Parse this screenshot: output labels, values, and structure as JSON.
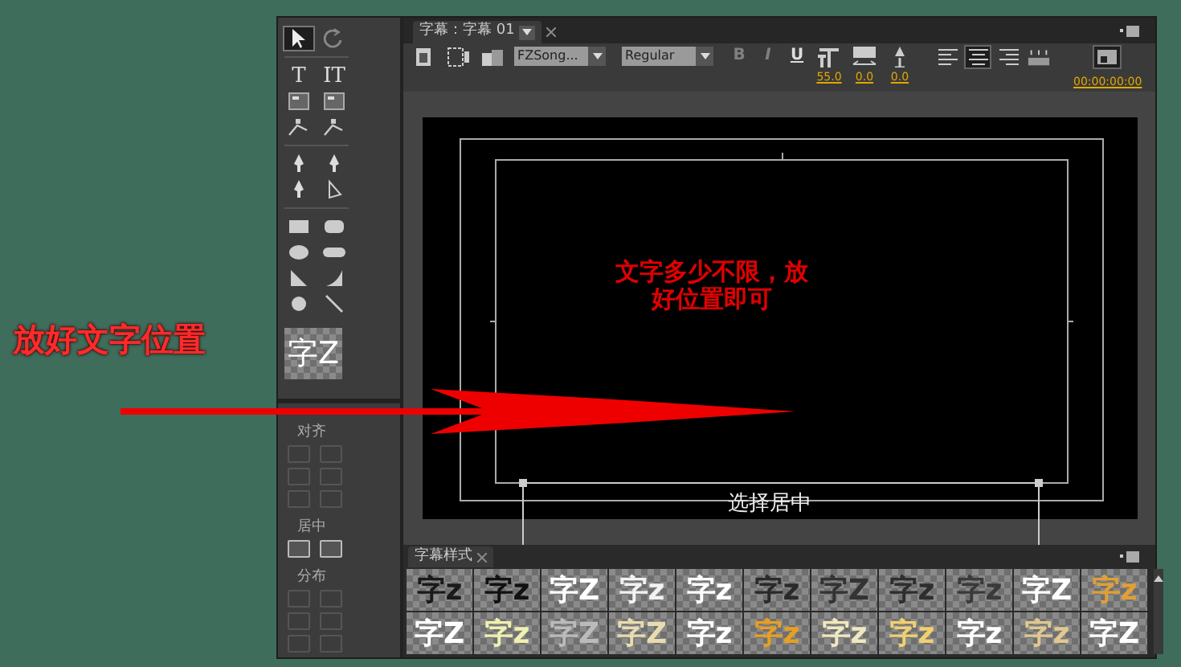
{
  "annotation": {
    "label": "放好文字位置"
  },
  "tools": [
    {
      "kind": "select",
      "selected": true
    },
    {
      "kind": "rotate",
      "selected": false
    },
    {
      "kind": "glyph",
      "label": "T",
      "selected": false
    },
    {
      "kind": "glyph",
      "label": "IT",
      "selected": false
    },
    {
      "kind": "area",
      "selected": false
    },
    {
      "kind": "area",
      "selected": false
    },
    {
      "kind": "path",
      "selected": false
    },
    {
      "kind": "path",
      "selected": false
    },
    {
      "kind": "pen",
      "selected": false
    },
    {
      "kind": "pen",
      "selected": false
    },
    {
      "kind": "pen",
      "selected": false
    },
    {
      "kind": "anchor",
      "selected": false
    },
    {
      "kind": "rect",
      "selected": false
    },
    {
      "kind": "roundrect",
      "selected": false
    },
    {
      "kind": "ellipse",
      "selected": false
    },
    {
      "kind": "pill",
      "selected": false
    },
    {
      "kind": "wedge",
      "selected": false
    },
    {
      "kind": "arc",
      "selected": false
    },
    {
      "kind": "circle",
      "selected": false
    },
    {
      "kind": "line",
      "selected": false
    }
  ],
  "tool_preview": {
    "label": "字Z"
  },
  "side_sections": [
    {
      "label": "对齐",
      "buttons": [
        {
          "disabled": true
        },
        {
          "disabled": true
        },
        {
          "disabled": true
        },
        {
          "disabled": true
        },
        {
          "disabled": true
        },
        {
          "disabled": true
        }
      ]
    },
    {
      "label": "居中",
      "buttons": [
        {
          "disabled": false
        },
        {
          "disabled": false
        }
      ]
    },
    {
      "label": "分布",
      "buttons": [
        {
          "disabled": true
        },
        {
          "disabled": true
        },
        {
          "disabled": true
        },
        {
          "disabled": true
        },
        {
          "disabled": true
        },
        {
          "disabled": true
        }
      ]
    }
  ],
  "panel_tab": {
    "label": "字幕：字幕 01"
  },
  "toolbar": {
    "font_family": "FZSong...",
    "font_style": "Regular",
    "format_buttons": [
      {
        "label": "B",
        "disabled": true
      },
      {
        "label": "I",
        "disabled": true
      },
      {
        "label": "U",
        "disabled": false
      }
    ],
    "font_size": "55.0",
    "kerning": "0.0",
    "leading": "0.0",
    "align_buttons": [
      {
        "selected": false
      },
      {
        "selected": true
      },
      {
        "selected": false
      }
    ],
    "timecode": "00:00:00:00"
  },
  "canvas": {
    "note_lines": [
      "文字多少不限，放",
      "好位置即可"
    ],
    "caption": "选择居中"
  },
  "styles_panel": {
    "title": "字幕样式",
    "swatches": [
      {
        "label": "字z",
        "color": "#1a1a1a"
      },
      {
        "label": "字z",
        "color": "#111111"
      },
      {
        "label": "字Z",
        "color": "#ffffff"
      },
      {
        "label": "字z",
        "color": "#f2f2f2"
      },
      {
        "label": "字z",
        "color": "#ffffff"
      },
      {
        "label": "字z",
        "color": "#2a2a2a"
      },
      {
        "label": "字Z",
        "color": "#333333"
      },
      {
        "label": "字z",
        "color": "#2e2e2e"
      },
      {
        "label": "字z",
        "color": "#3a3a3a"
      },
      {
        "label": "字Z",
        "color": "#ffffff"
      },
      {
        "label": "字z",
        "color": "#e0a035"
      },
      {
        "label": "字Z",
        "color": "#ffffff"
      },
      {
        "label": "字z",
        "color": "#f0f0b0"
      },
      {
        "label": "字Z",
        "color": "#bbbbbb"
      },
      {
        "label": "字Z",
        "color": "#e8dcb0"
      },
      {
        "label": "字z",
        "color": "#ffffff"
      },
      {
        "label": "字z",
        "color": "#e8a020"
      },
      {
        "label": "字z",
        "color": "#f0e8c0"
      },
      {
        "label": "字z",
        "color": "#f0d070"
      },
      {
        "label": "字z",
        "color": "#ffffff"
      },
      {
        "label": "字z",
        "color": "#e0c890"
      },
      {
        "label": "字Z",
        "color": "#ffffff"
      }
    ]
  }
}
